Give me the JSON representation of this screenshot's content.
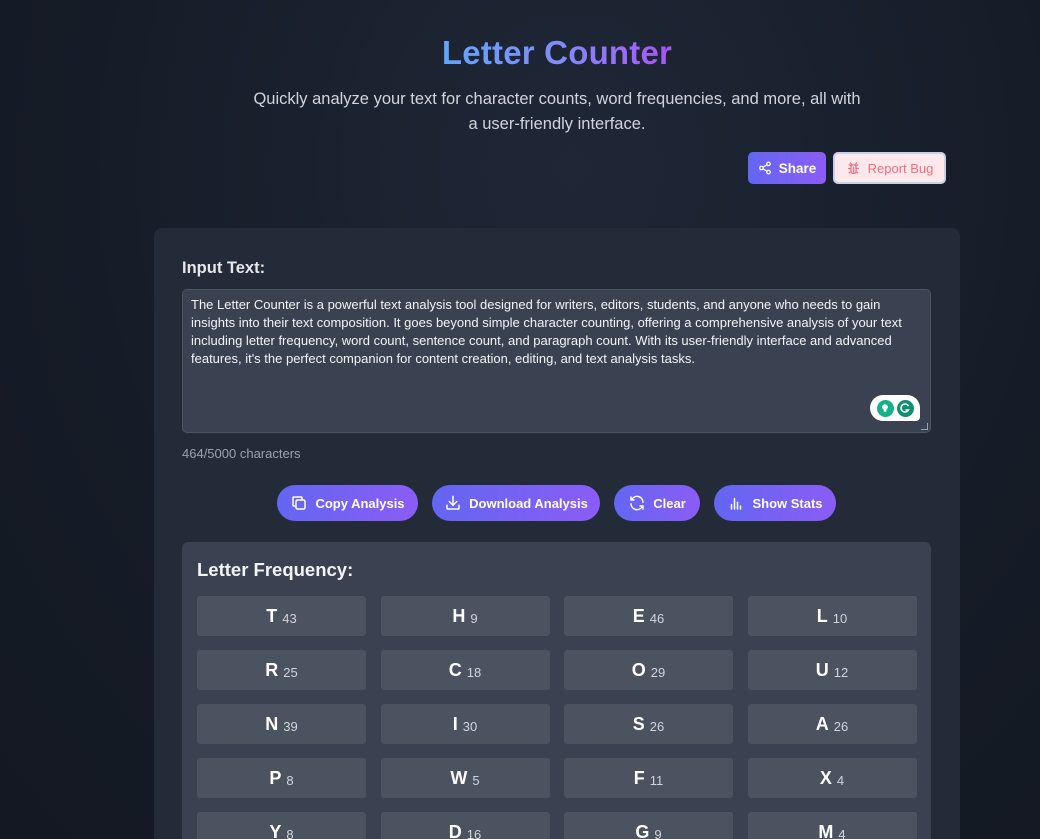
{
  "header": {
    "title": "Letter Counter",
    "subtitle": "Quickly analyze your text for character counts, word frequencies, and more, all with a user-friendly interface.",
    "share_label": "Share",
    "report_bug_label": "Report Bug"
  },
  "input": {
    "label": "Input Text:",
    "value": "The Letter Counter is a powerful text analysis tool designed for writers, editors, students, and anyone who needs to gain insights into their text composition. It goes beyond simple character counting, offering a comprehensive analysis of your text including letter frequency, word count, sentence count, and paragraph count. With its user-friendly interface and advanced features, it's the perfect companion for content creation, editing, and text analysis tasks.",
    "char_count": "464/5000 characters"
  },
  "actions": {
    "copy_label": "Copy Analysis",
    "download_label": "Download Analysis",
    "clear_label": "Clear",
    "stats_label": "Show Stats"
  },
  "frequency": {
    "title": "Letter Frequency:",
    "items": [
      {
        "letter": "T",
        "count": "43"
      },
      {
        "letter": "H",
        "count": "9"
      },
      {
        "letter": "E",
        "count": "46"
      },
      {
        "letter": "L",
        "count": "10"
      },
      {
        "letter": "R",
        "count": "25"
      },
      {
        "letter": "C",
        "count": "18"
      },
      {
        "letter": "O",
        "count": "29"
      },
      {
        "letter": "U",
        "count": "12"
      },
      {
        "letter": "N",
        "count": "39"
      },
      {
        "letter": "I",
        "count": "30"
      },
      {
        "letter": "S",
        "count": "26"
      },
      {
        "letter": "A",
        "count": "26"
      },
      {
        "letter": "P",
        "count": "8"
      },
      {
        "letter": "W",
        "count": "5"
      },
      {
        "letter": "F",
        "count": "11"
      },
      {
        "letter": "X",
        "count": "4"
      },
      {
        "letter": "Y",
        "count": "8"
      },
      {
        "letter": "D",
        "count": "16"
      },
      {
        "letter": "G",
        "count": "9"
      },
      {
        "letter": "M",
        "count": "4"
      }
    ]
  },
  "colors": {
    "accent_start": "#6366f1",
    "accent_end": "#8b5cf6",
    "title_gradient_start": "#60a5fa",
    "title_gradient_end": "#a855f7",
    "bug_text": "#ef6f7f"
  },
  "icons": [
    "share-icon",
    "bug-icon",
    "copy-icon",
    "download-icon",
    "refresh-icon",
    "bar-chart-icon",
    "grammarly-icon"
  ]
}
